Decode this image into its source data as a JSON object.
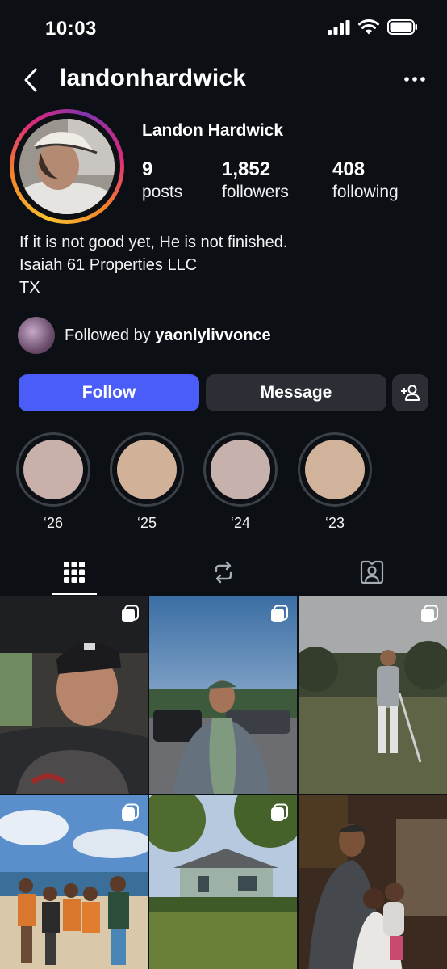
{
  "status_bar": {
    "time": "10:03"
  },
  "header": {
    "username": "landonhardwick"
  },
  "profile": {
    "display_name": "Landon Hardwick",
    "stats": [
      {
        "value": "9",
        "label": "posts"
      },
      {
        "value": "1,852",
        "label": "followers"
      },
      {
        "value": "408",
        "label": "following"
      }
    ],
    "bio": [
      "If it is not good yet, He is not finished.",
      "Isaiah 61 Properties LLC",
      "TX"
    ],
    "followed_by_prefix": "Followed by ",
    "followed_by_user": "yaonlylivvonce"
  },
  "actions": {
    "follow": "Follow",
    "message": "Message"
  },
  "highlights": [
    {
      "label": "‘26",
      "color": "#c9b0ab"
    },
    {
      "label": "‘25",
      "color": "#d1b299"
    },
    {
      "label": "‘24",
      "color": "#c7b1ad"
    },
    {
      "label": "‘23",
      "color": "#d1b39c"
    }
  ],
  "colors": {
    "accent": "#4a5df9",
    "background": "#0c0f14",
    "button_secondary": "#2b2e34"
  }
}
